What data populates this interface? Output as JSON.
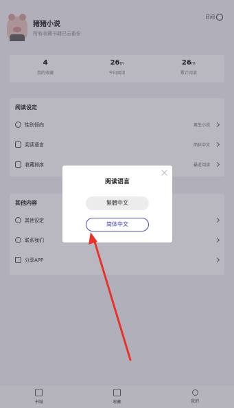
{
  "profile": {
    "name": "猪猪小说",
    "subtitle": "所有收藏书籍已云备份",
    "day_mode_label": "日间"
  },
  "stats": [
    {
      "value": "4",
      "unit": "",
      "label": "我的收藏"
    },
    {
      "value": "26",
      "unit": "m",
      "label": "今日阅读"
    },
    {
      "value": "26",
      "unit": "m",
      "label": "累计阅读"
    }
  ],
  "reading_settings": {
    "title": "阅读设定",
    "rows": [
      {
        "label": "性别倾向",
        "value": "男生小说"
      },
      {
        "label": "阅读语言",
        "value": "简体中文"
      },
      {
        "label": "收藏排序",
        "value": "最近阅读"
      }
    ]
  },
  "other": {
    "title": "其他内容",
    "rows": [
      {
        "label": "其他设定",
        "value": ""
      },
      {
        "label": "联系我们",
        "value": ""
      },
      {
        "label": "分享APP",
        "value": ""
      }
    ]
  },
  "tabs": [
    {
      "label": "书城",
      "icon": "home-icon"
    },
    {
      "label": "收藏",
      "icon": "bookmark-icon"
    },
    {
      "label": "我的",
      "icon": "user-icon"
    }
  ],
  "dialog": {
    "title": "阅读语言",
    "options": [
      "繁體中文",
      "简体中文"
    ],
    "selected": "简体中文"
  },
  "colors": {
    "accent": "#4a4ac0",
    "arrow": "#e8322b",
    "overlay": "#2a2840"
  }
}
